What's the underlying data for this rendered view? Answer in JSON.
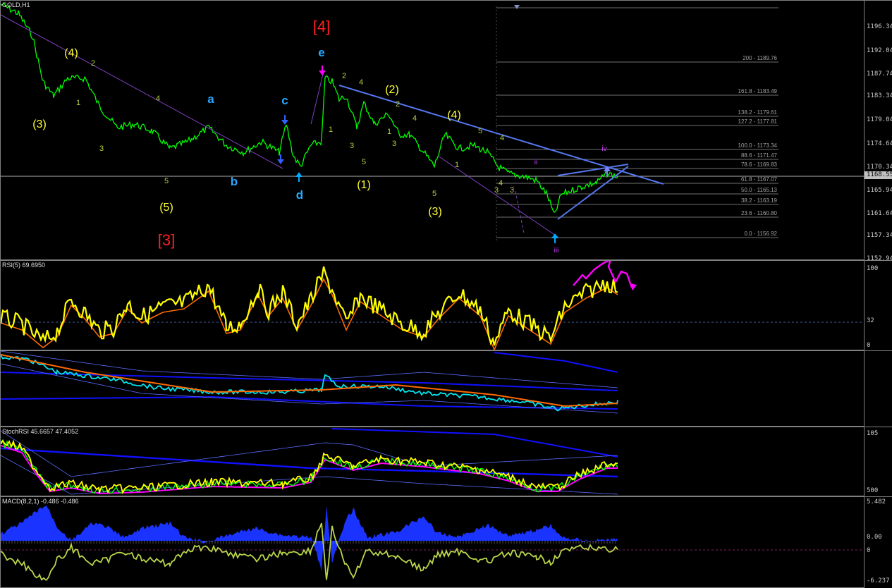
{
  "price_pane": {
    "title": "GOLD,H1",
    "current_price": "1168.55",
    "axis_ticks": [
      "1196.34",
      "1192.04",
      "1187.74",
      "1183.34",
      "1179.04",
      "1174.64",
      "1170.34",
      "1165.94",
      "1161.64",
      "1157.34",
      "1152.94"
    ],
    "fib_levels": [
      {
        "label": "200 - 1189.76"
      },
      {
        "label": "161.8 - 1183.49"
      },
      {
        "label": "138.2 - 1179.61"
      },
      {
        "label": "127.2 - 1177.81"
      },
      {
        "label": "100.0 - 1173.34"
      },
      {
        "label": "88.6 - 1171.47"
      },
      {
        "label": "78.6 - 1169.83"
      },
      {
        "label": "61.8 - 1167.07"
      },
      {
        "label": "50.0 - 1165.13"
      },
      {
        "label": "38.2 - 1163.19"
      },
      {
        "label": "23.6 - 1160.80"
      },
      {
        "label": "0.0 - 1156.92"
      }
    ],
    "wave_labels": {
      "red": [
        "[4]",
        "[3]"
      ],
      "yellow": [
        "(4)",
        "(3)",
        "(5)",
        "(2)",
        "(4)",
        "(1)",
        "(3)"
      ],
      "cyan": [
        "a",
        "b",
        "c",
        "d",
        "e"
      ],
      "small": [
        "2",
        "1",
        "3",
        "4",
        "5",
        "1",
        "3",
        "2",
        "4",
        "5",
        "3",
        "2",
        "4",
        "1",
        "5",
        "1",
        "3",
        "4",
        "5",
        "4",
        "3"
      ],
      "magenta": [
        "ii",
        "i",
        "iii",
        "iv"
      ]
    }
  },
  "rsi_pane": {
    "title": "RSI(5) 69.6950",
    "axis_ticks": [
      "100",
      "32",
      "0"
    ],
    "colors": {
      "rsi": "#ffff00",
      "signal": "#ff6a00",
      "arrow": "#ff00ff"
    }
  },
  "bands_pane": {
    "colors": {
      "main": "#00e5ee",
      "ma": "#ff6a00",
      "band": "#1010ff",
      "thin": "#5b6cff"
    }
  },
  "stoch_pane": {
    "title": "StochRSI 45.6657 47.4052",
    "axis_ticks": [
      "105",
      "500"
    ],
    "colors": {
      "k": "#ffff00",
      "d": "#ff00ff",
      "g": "#00ff00",
      "band": "#1010ff"
    }
  },
  "macd_pane": {
    "title": "MACD(8,2,1) -0.486 -0.486",
    "axis_ticks": [
      "5.482",
      "0.00",
      "0",
      "-6.237"
    ],
    "colors": {
      "hist": "#1a33ff",
      "signal": "#b9d64a"
    }
  }
}
